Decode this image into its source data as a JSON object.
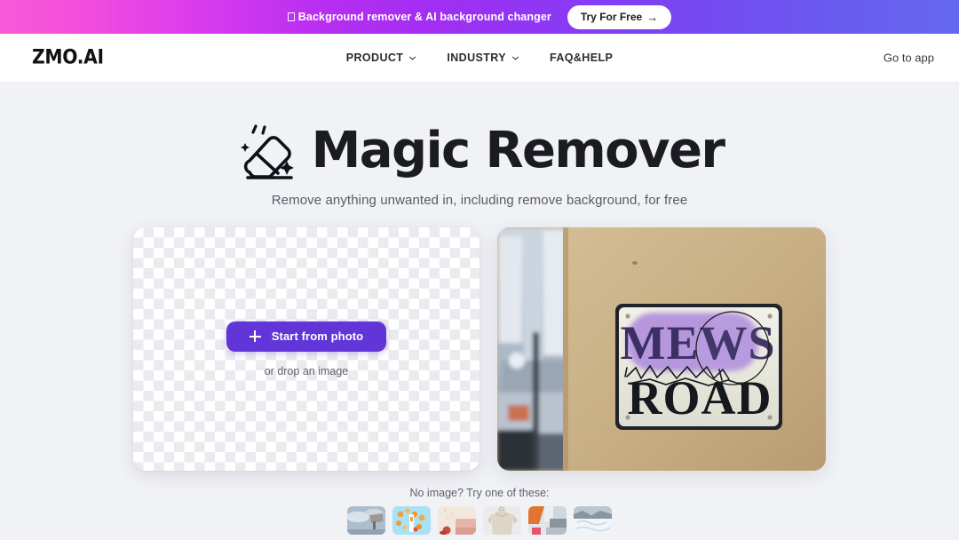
{
  "promo": {
    "icon": "missing-glyph-box",
    "text": "Background remover & AI background changer",
    "cta_label": "Try For Free",
    "cta_arrow": "→",
    "gradient_from": "#f85ad8",
    "gradient_mid": "#b62ef0",
    "gradient_to": "#6468ef"
  },
  "nav": {
    "logo": "ZMO.AI",
    "links": [
      {
        "label": "PRODUCT",
        "has_dropdown": true,
        "icon": "chevron-down-icon"
      },
      {
        "label": "INDUSTRY",
        "has_dropdown": true,
        "icon": "chevron-down-icon"
      },
      {
        "label": "FAQ&HELP",
        "has_dropdown": false,
        "icon": ""
      }
    ],
    "go_to_app": "Go to app"
  },
  "hero": {
    "icon": "eraser-sparkle-icon",
    "title": "Magic Remover",
    "subtitle": "Remove anything unwanted in, including remove background, for free"
  },
  "upload": {
    "button_label": "Start from photo",
    "button_icon": "plus-icon",
    "button_color": "#6135d8",
    "drop_hint": "or drop an image"
  },
  "demo": {
    "alt": "Street sign on stucco wall reading MEWS ROAD with purple selection highlight and brush circle",
    "sign_line_1": "MEWS",
    "sign_line_2": "ROAD",
    "highlight_color": "#b696dd",
    "wall_color": "#c9b084"
  },
  "samples": {
    "label": "No image? Try one of these:",
    "thumbs": [
      {
        "name": "sky-mailbox-thumb",
        "colors": [
          "#aebdcd",
          "#d7dee6",
          "#8d8f8b"
        ]
      },
      {
        "name": "confetti-balloons-thumb",
        "colors": [
          "#a9e1f5",
          "#f0a03c",
          "#ffffff"
        ]
      },
      {
        "name": "beige-product-thumb",
        "colors": [
          "#f2e7dc",
          "#e8b3a8",
          "#c94b3c"
        ]
      },
      {
        "name": "hanging-shirt-thumb",
        "colors": [
          "#ebebeb",
          "#ddd6c6",
          "#c4bba8"
        ]
      },
      {
        "name": "interior-room-thumb",
        "colors": [
          "#e0752f",
          "#dfe3e8",
          "#e8556a"
        ]
      },
      {
        "name": "snow-landscape-thumb",
        "colors": [
          "#e9edf2",
          "#8795a4",
          "#c8d2dc"
        ]
      }
    ]
  }
}
